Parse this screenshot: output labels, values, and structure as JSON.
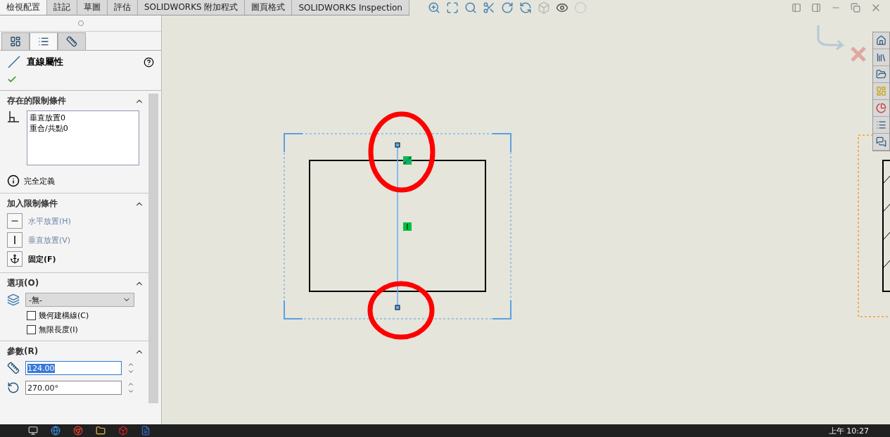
{
  "tabs": [
    {
      "label": "檢視配置",
      "selected": true
    },
    {
      "label": "註記",
      "selected": false
    },
    {
      "label": "草圖",
      "selected": false
    },
    {
      "label": "評估",
      "selected": false
    },
    {
      "label": "SOLIDWORKS 附加程式",
      "selected": false
    },
    {
      "label": "圖頁格式",
      "selected": false
    },
    {
      "label": "SOLIDWORKS Inspection",
      "selected": false
    }
  ],
  "panel_tabs": [
    {
      "kind": "properties",
      "selected": false
    },
    {
      "kind": "list",
      "selected": true
    },
    {
      "kind": "dimxpert",
      "selected": false
    }
  ],
  "property": {
    "title": "直線屬性"
  },
  "existing_relations": {
    "title": "存在的限制條件",
    "items": [
      "垂直放置0",
      "重合/共點0"
    ],
    "status": "完全定義"
  },
  "add_relations": {
    "title": "加入限制條件",
    "items": [
      {
        "kind": "horizontal",
        "label": "水平放置(H)",
        "disabled": true
      },
      {
        "kind": "vertical",
        "label": "垂直放置(V)",
        "disabled": true
      },
      {
        "kind": "fix",
        "label": "固定(F)",
        "disabled": false
      }
    ]
  },
  "options": {
    "title": "選項(O)",
    "dropdown": "-無-",
    "checkboxes": [
      {
        "label": "幾何建構線(C)",
        "checked": false
      },
      {
        "label": "無限長度(I)",
        "checked": false
      }
    ]
  },
  "parameters": {
    "title": "參數(R)",
    "fields": [
      {
        "kind": "length",
        "value": "124.00",
        "selected": true
      },
      {
        "kind": "angle",
        "value": "270.00°",
        "selected": false
      }
    ]
  },
  "taskbar": {
    "clock": "上午 10:27"
  }
}
